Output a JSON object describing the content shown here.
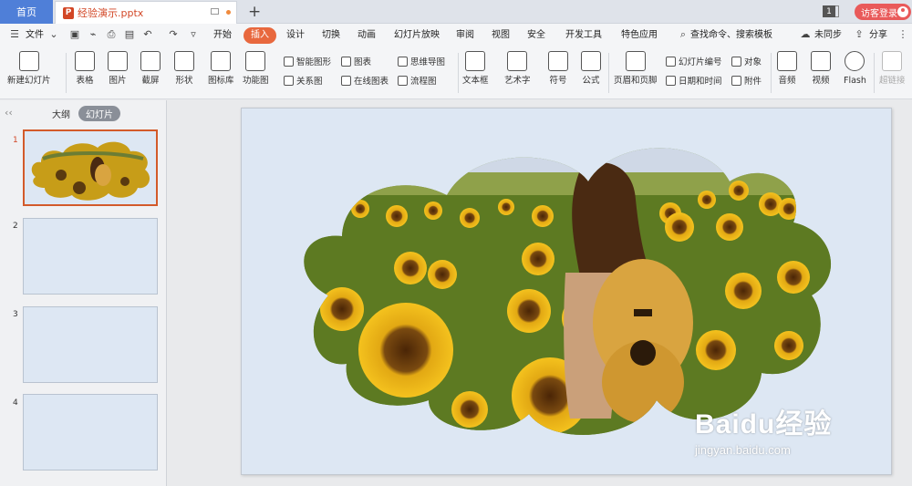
{
  "titlebar": {
    "home_tab": "首页",
    "doc_icon_letter": "P",
    "doc_name": "经验演示.pptx",
    "new_tab": "+",
    "page_badge": "1",
    "login_label": "访客登录"
  },
  "menu": {
    "file": "文件",
    "items": [
      "开始",
      "插入",
      "设计",
      "切换",
      "动画",
      "幻灯片放映",
      "审阅",
      "视图",
      "安全",
      "开发工具",
      "特色应用"
    ],
    "active": "插入",
    "search": "查找命令、搜索模板",
    "sync": "未同步",
    "share": "分享"
  },
  "ribbon": {
    "new_slide": "新建幻灯片",
    "table": "表格",
    "picture": "图片",
    "screenshot": "截屏",
    "shape": "形状",
    "icon_lib": "图标库",
    "function_chart": "功能图",
    "smart_art": "智能图形",
    "chart": "图表",
    "relation": "关系图",
    "online_chart": "在线图表",
    "mindmap": "思维导图",
    "flowchart": "流程图",
    "textbox": "文本框",
    "wordart": "艺术字",
    "symbol": "符号",
    "formula": "公式",
    "header_footer": "页眉和页脚",
    "slide_number": "幻灯片编号",
    "object": "对象",
    "datetime": "日期和时间",
    "attachment": "附件",
    "audio": "音频",
    "video": "视频",
    "flash": "Flash",
    "hyperlink": "超链接"
  },
  "panel": {
    "outline_tab": "大纲",
    "slides_tab": "幻灯片",
    "slides": [
      {
        "num": "1",
        "has_image": true
      },
      {
        "num": "2",
        "has_image": false
      },
      {
        "num": "3",
        "has_image": false
      },
      {
        "num": "4",
        "has_image": false
      }
    ]
  },
  "watermark": {
    "brand": "Baidu经验",
    "url": "jingyan.baidu.com"
  },
  "colors": {
    "accent": "#e8683e",
    "home_tab": "#4f7fd8",
    "slide_bg": "#dde7f3",
    "login": "#e95a5a"
  }
}
